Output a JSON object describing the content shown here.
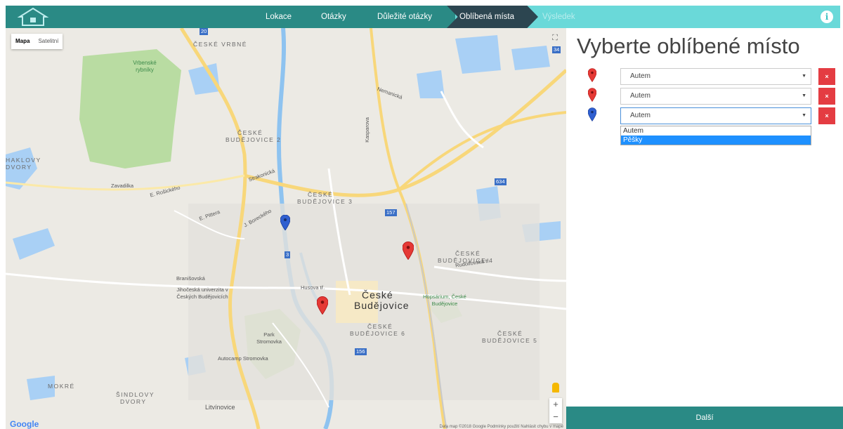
{
  "nav": {
    "items": [
      {
        "label": "Lokace",
        "state": "done"
      },
      {
        "label": "Otázky",
        "state": "done"
      },
      {
        "label": "Důležité otázky",
        "state": "done"
      },
      {
        "label": "Oblíbená místa",
        "state": "active"
      },
      {
        "label": "Výsledek",
        "state": "upcoming"
      }
    ],
    "info_icon": "i"
  },
  "map": {
    "type_control": {
      "map_label": "Mapa",
      "satellite_label": "Satelitní",
      "selected": "Mapa"
    },
    "labels": {
      "ceske_vrbne": "ČESKÉ VRBNÉ",
      "vrbenske": "Vrbenské rybníky",
      "cb2_a": "ČESKÉ",
      "cb2_b": "BUDĚJOVICE 2",
      "haklovy_a": "HAKLOVY",
      "haklovy_b": "DVORY",
      "cb3_a": "ČESKÉ",
      "cb3_b": "BUDĚJOVICE 3",
      "cb4_a": "ČESKÉ",
      "cb4_b": "BUDĚJOVICE 4",
      "city_a": "České",
      "city_b": "Budějovice",
      "cb6_a": "ČESKÉ",
      "cb6_b": "BUDĚJOVICE 6",
      "cb5_a": "ČESKÉ",
      "cb5_b": "BUDĚJOVICE 5",
      "jihoceska": "Jihočeská univerzita v Českých Budějovicích",
      "park": "Park Stromovka",
      "autocamp": "Autocamp Stromovka",
      "hopsarium": "Hopsárium, České Budějovice",
      "mokre": "MOKRÉ",
      "sindlovy_a": "ŠINDLOVY",
      "sindlovy_b": "DVORY",
      "litvinovice": "Litvínovice",
      "zavadilka": "Zavadilka",
      "strakonicka": "Strakonická",
      "nemanicka": "Nemanická",
      "husova": "Husova tř.",
      "branisovska": "Branišovská",
      "rudolfovska": "Rudolfovská tř.",
      "e_rosickeho": "E. Rošického",
      "e_pittera": "E. Pittera",
      "j_bozeka": "J. Boreckého",
      "kaspar": "Kasparova"
    },
    "road_badges": {
      "r20": "20",
      "r3": "3",
      "r157": "157",
      "r634": "634",
      "r34": "34",
      "r156": "156"
    },
    "google_logo": "Google",
    "attribution": "Data map ©2018 Google  Podmínky použití  Nahlásit chybu v mapě",
    "zoom_in": "+",
    "zoom_out": "−",
    "fullscreen_icon": "⛶",
    "pins": [
      {
        "color": "#2f5fd0",
        "kind": "blue"
      },
      {
        "color": "#e53935",
        "kind": "red"
      },
      {
        "color": "#e53935",
        "kind": "red"
      }
    ]
  },
  "panel": {
    "title": "Vyberte oblíbené místo",
    "rows": [
      {
        "pin_color": "#e53935",
        "value": "Autem",
        "delete_label": "×"
      },
      {
        "pin_color": "#e53935",
        "value": "Autem",
        "delete_label": "×"
      },
      {
        "pin_color": "#2f5fd0",
        "value": "Autem",
        "delete_label": "×"
      }
    ],
    "dropdown_options": [
      "Autem",
      "Pěšky"
    ],
    "dropdown_highlighted": "Pěšky",
    "next_label": "Další"
  },
  "colors": {
    "nav_dark": "#2a8a85",
    "nav_light": "#6ad9d9",
    "nav_active": "#2c4550",
    "delete": "#e43c42",
    "highlight": "#1e90ff"
  }
}
